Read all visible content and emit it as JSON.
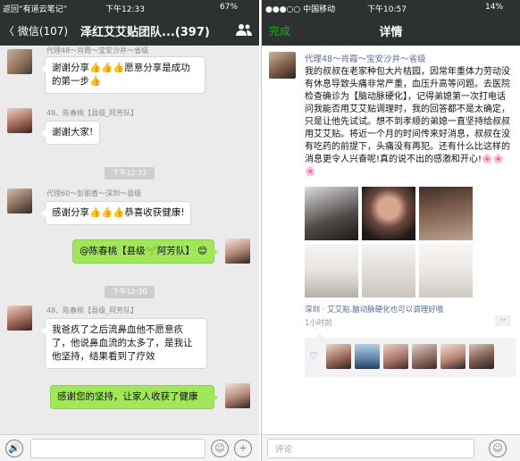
{
  "left": {
    "status": {
      "back_app": "返回“有道云笔记”",
      "time": "下午12:33",
      "battery": "67%"
    },
    "nav": {
      "back": "〈 微信(107)",
      "title": "泽红艾艾贴团队...(397)"
    },
    "messages": [
      {
        "sender": "代理48～肖霞～宝安沙井～省级",
        "text": "谢谢分享👍👍👍愿意分享是成功的第一步👍"
      },
      {
        "sender": "48、陈春桃【县级_阿芳队】",
        "text": "谢谢大家!"
      },
      {
        "time": "下午12:22"
      },
      {
        "sender": "代理60～彭丽香～深圳～县级",
        "text": "感谢分享👍👍👍恭喜收获健康!"
      },
      {
        "text": "@陈春桃【县级🌱阿芳队】 😊"
      },
      {
        "time": "下午12:30"
      },
      {
        "sender": "48、陈春桃【县级_阿芳队】",
        "text": "我爸疚了之后流鼻血他不愿意疚了，他说鼻血流的太多了，是我让他坚持，结果看到了疗效"
      },
      {
        "text": "感谢您的坚持，让家人收获了健康"
      }
    ],
    "input": {
      "voice_icon": "🔊",
      "emoji_icon": "☺",
      "plus_icon": "+"
    }
  },
  "right": {
    "status": {
      "carrier": "●●●○○ 中国移动",
      "time": "下午10:57",
      "battery": "14%"
    },
    "nav": {
      "done": "完成",
      "title": "详情"
    },
    "post": {
      "author": "代理48～肖霞～宝安沙井～省级",
      "text": "我的叔叔在老家种包大片桔园，因常年重体力劳动没有休息导致头痛非常严重，血压升高等问题。去医院检查确诊为【脑动脉硬化】，记得弟媳第一次打电话问我能否用艾艾贴调理时，我的回答都不是太确定，只是让他先试试。想不到孝顺的弟媳一直坚持给叔叔用艾艾贴。将近一个月的时间传来好消息，叔叔在没有吃药的前提下，头痛没有再犯。还有什么比这样的消息更令人兴奋呢!真的说不出的感激和开心!🌸🌸🌸",
      "location": "深圳 · 艾艾贴.脑动脉硬化也可以调理好哦",
      "ago": "1小时前",
      "more": "··"
    },
    "comment": {
      "placeholder": "评论",
      "emoji_icon": "☺"
    },
    "colors": {
      "accent_green": "#1aad19",
      "link_blue": "#566b94",
      "bubble_green": "#a0e75a"
    }
  }
}
